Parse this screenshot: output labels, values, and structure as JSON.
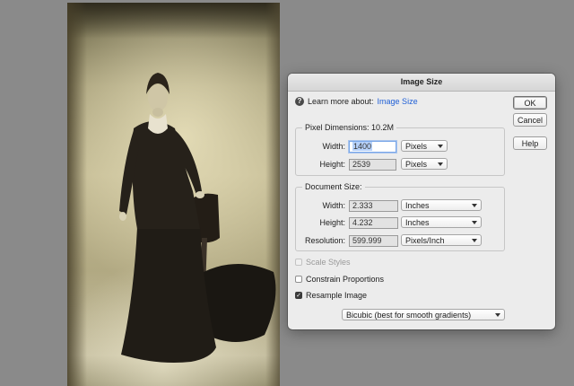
{
  "dialog": {
    "title": "Image Size",
    "learn_prefix": "Learn more about:",
    "learn_link": "Image Size",
    "buttons": {
      "ok": "OK",
      "cancel": "Cancel",
      "help": "Help"
    },
    "pixel_dimensions": {
      "title": "Pixel Dimensions: 10.2M",
      "width_label": "Width:",
      "width_value": "1400",
      "width_unit": "Pixels",
      "height_label": "Height:",
      "height_value": "2539",
      "height_unit": "Pixels"
    },
    "document_size": {
      "title": "Document Size:",
      "width_label": "Width:",
      "width_value": "2.333",
      "width_unit": "Inches",
      "height_label": "Height:",
      "height_value": "4.232",
      "height_unit": "Inches",
      "resolution_label": "Resolution:",
      "resolution_value": "599.999",
      "resolution_unit": "Pixels/Inch"
    },
    "options": {
      "scale_styles": {
        "label": "Scale Styles",
        "checked": false,
        "enabled": false
      },
      "constrain_proportions": {
        "label": "Constrain Proportions",
        "checked": false,
        "enabled": true
      },
      "resample_image": {
        "label": "Resample Image",
        "checked": true,
        "enabled": true
      }
    },
    "resample_method": "Bicubic (best for smooth gradients)"
  },
  "colors": {
    "workspace": "#8a8a8a",
    "dialog_bg": "#ececec",
    "link": "#1f5fd6",
    "field_focus": "#7aa7e8"
  },
  "icons": [
    "help-circle-icon",
    "chevron-down-icon",
    "checkmark-icon"
  ]
}
